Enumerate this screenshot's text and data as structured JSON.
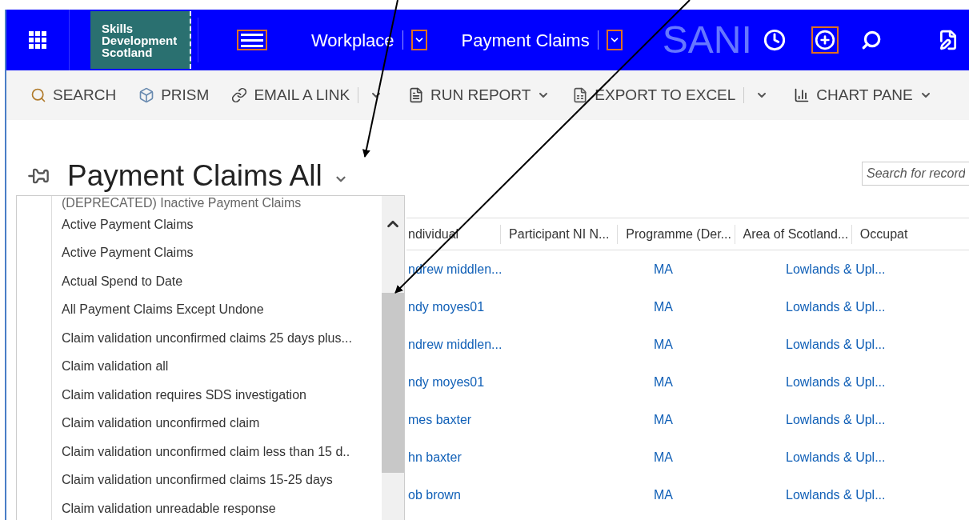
{
  "nav": {
    "logo_lines": [
      "Skills",
      "Development",
      "Scotland"
    ],
    "breadcrumbs": [
      {
        "label": "Workplace"
      },
      {
        "label": "Payment Claims"
      }
    ],
    "faded_text": "SANI"
  },
  "toolbar": [
    {
      "label": "SEARCH",
      "kind": "plain"
    },
    {
      "label": "PRISM",
      "kind": "plain"
    },
    {
      "label": "EMAIL A LINK",
      "kind": "split"
    },
    {
      "label": "RUN REPORT",
      "kind": "menu"
    },
    {
      "label": "EXPORT TO EXCEL",
      "kind": "split"
    },
    {
      "label": "CHART PANE",
      "kind": "menu"
    }
  ],
  "view": {
    "title": "Payment Claims All"
  },
  "search": {
    "placeholder": "Search for record"
  },
  "view_menu": {
    "items": [
      "(DEPRECATED) Inactive Payment Claims",
      "Active Payment Claims",
      "Active Payment Claims",
      "Actual Spend to Date",
      "All Payment Claims Except Undone",
      "Claim validation unconfirmed claims 25 days plus...",
      "Claim validation all",
      "Claim validation requires SDS investigation",
      "Claim validation unconfirmed claim",
      "Claim validation unconfirmed claim less than 15 d..",
      "Claim validation unconfirmed claims 15-25 days",
      "Claim validation unreadable response"
    ]
  },
  "grid": {
    "columns": [
      "ndividual",
      "Participant NI N...",
      "Programme (Der...",
      "Area of Scotland...",
      "Occupat"
    ],
    "rows": [
      {
        "individual": "ndrew middlen...",
        "programme": "MA",
        "area": "Lowlands & Upl..."
      },
      {
        "individual": "ndy moyes01",
        "programme": "MA",
        "area": "Lowlands & Upl..."
      },
      {
        "individual": "ndrew middlen...",
        "programme": "MA",
        "area": "Lowlands & Upl..."
      },
      {
        "individual": "ndy moyes01",
        "programme": "MA",
        "area": "Lowlands & Upl..."
      },
      {
        "individual": "mes baxter",
        "programme": "MA",
        "area": "Lowlands & Upl..."
      },
      {
        "individual": "hn baxter",
        "programme": "MA",
        "area": "Lowlands & Upl..."
      },
      {
        "individual": "ob brown",
        "programme": "MA",
        "area": "Lowlands & Upl..."
      }
    ]
  }
}
